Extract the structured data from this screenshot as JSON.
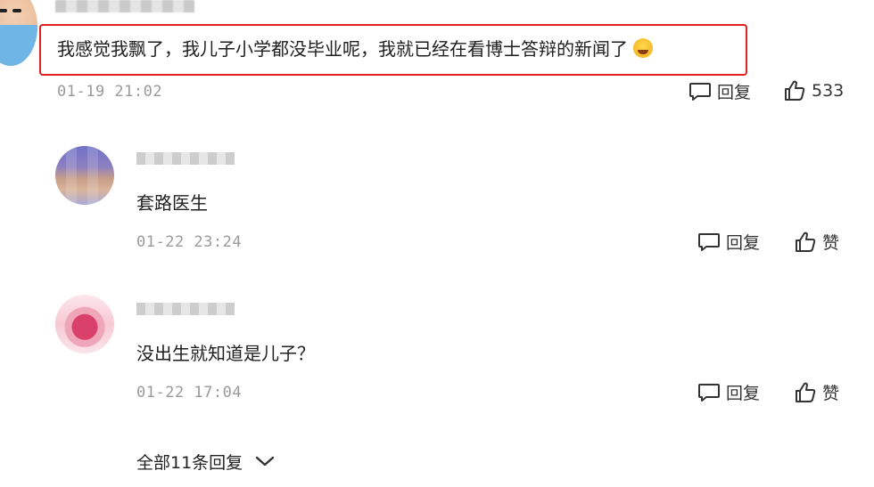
{
  "main_comment": {
    "text": "我感觉我飘了，我儿子小学都没毕业呢，我就已经在看博士答辩的新闻了",
    "emoji_icon": "laughing-tears-emoji",
    "timestamp": "01-19 21:02",
    "reply_label": "回复",
    "like_count": "533"
  },
  "replies": [
    {
      "text": "套路医生",
      "timestamp": "01-22 23:24",
      "reply_label": "回复",
      "like_label": "赞"
    },
    {
      "text": "没出生就知道是儿子？",
      "timestamp": "01-22 17:04",
      "reply_label": "回复",
      "like_label": "赞"
    }
  ],
  "all_replies_label": "全部11条回复",
  "colors": {
    "highlight": "#e02020",
    "timestamp": "#9a9a9a",
    "text": "#1f1f1f"
  }
}
